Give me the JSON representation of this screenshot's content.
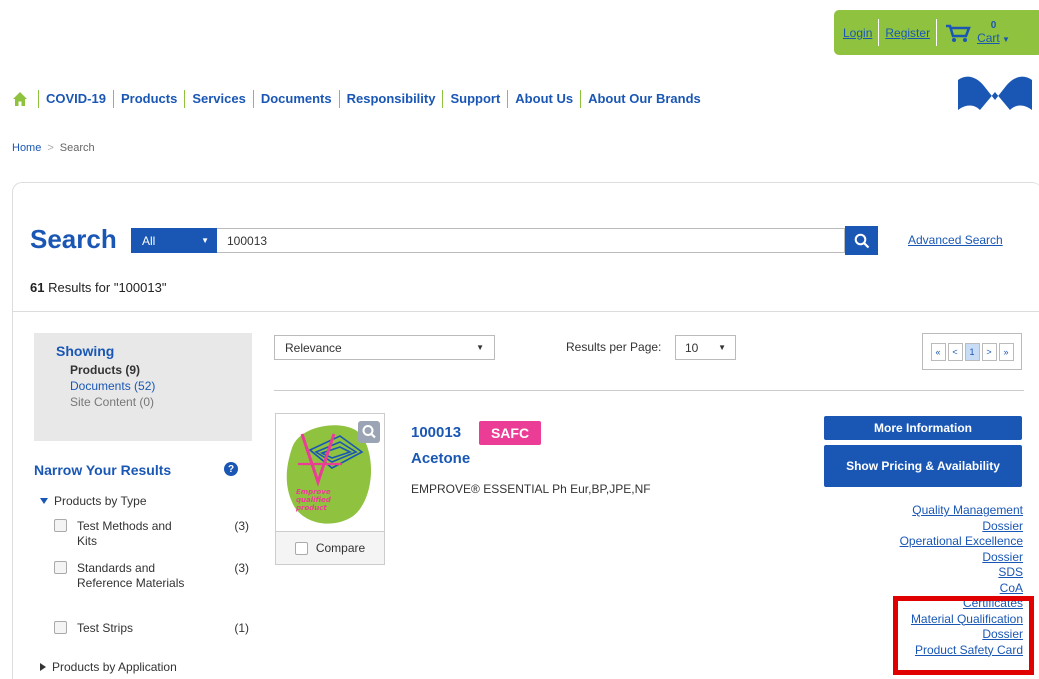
{
  "account": {
    "login": "Login",
    "register": "Register",
    "cart_count": "0",
    "cart_label": "Cart"
  },
  "nav": {
    "items": [
      "COVID-19",
      "Products",
      "Services",
      "Documents",
      "Responsibility",
      "Support",
      "About Us",
      "About Our Brands"
    ]
  },
  "breadcrumb": {
    "home": "Home",
    "separator": ">",
    "current": "Search"
  },
  "search": {
    "title": "Search",
    "scope": "All",
    "query": "100013",
    "advanced": "Advanced Search",
    "results_count": "61",
    "results_text": " Results for \"100013\""
  },
  "sidebar": {
    "showing_title": "Showing",
    "products": "Products (9)",
    "documents": "Documents (52)",
    "site_content": "Site Content (0)",
    "narrow_title": "Narrow Your Results",
    "help": "?",
    "products_by_type": "Products by Type",
    "filters": [
      {
        "label": "Test Methods and Kits",
        "count": "(3)"
      },
      {
        "label": "Standards and Reference Materials",
        "count": "(3)"
      },
      {
        "label": "Test Strips",
        "count": "(1)"
      }
    ],
    "products_by_application": "Products by Application"
  },
  "controls": {
    "sort": "Relevance",
    "rpp_label": "Results per Page:",
    "rpp": "10",
    "pager": [
      "«",
      "<",
      "1",
      ">",
      "»"
    ]
  },
  "product": {
    "id": "100013",
    "badge": "SAFC",
    "name": "Acetone",
    "description": "EMPROVE® ESSENTIAL Ph Eur,BP,JPE,NF",
    "compare": "Compare",
    "image_text": [
      "Emprove",
      "qualified",
      "product"
    ],
    "more_info": "More Information",
    "pricing": "Show Pricing & Availability",
    "doc_links": [
      "Quality Management",
      "Dossier",
      "Operational Excellence",
      "Dossier",
      "SDS",
      "CoA",
      "Certificates",
      "Material Qualification",
      "Dossier",
      "Product Safety Card"
    ]
  },
  "colors": {
    "brand_blue": "#1a57b5",
    "green": "#8fc23f",
    "magenta": "#eb3c96",
    "highlight_red": "#e00000"
  }
}
